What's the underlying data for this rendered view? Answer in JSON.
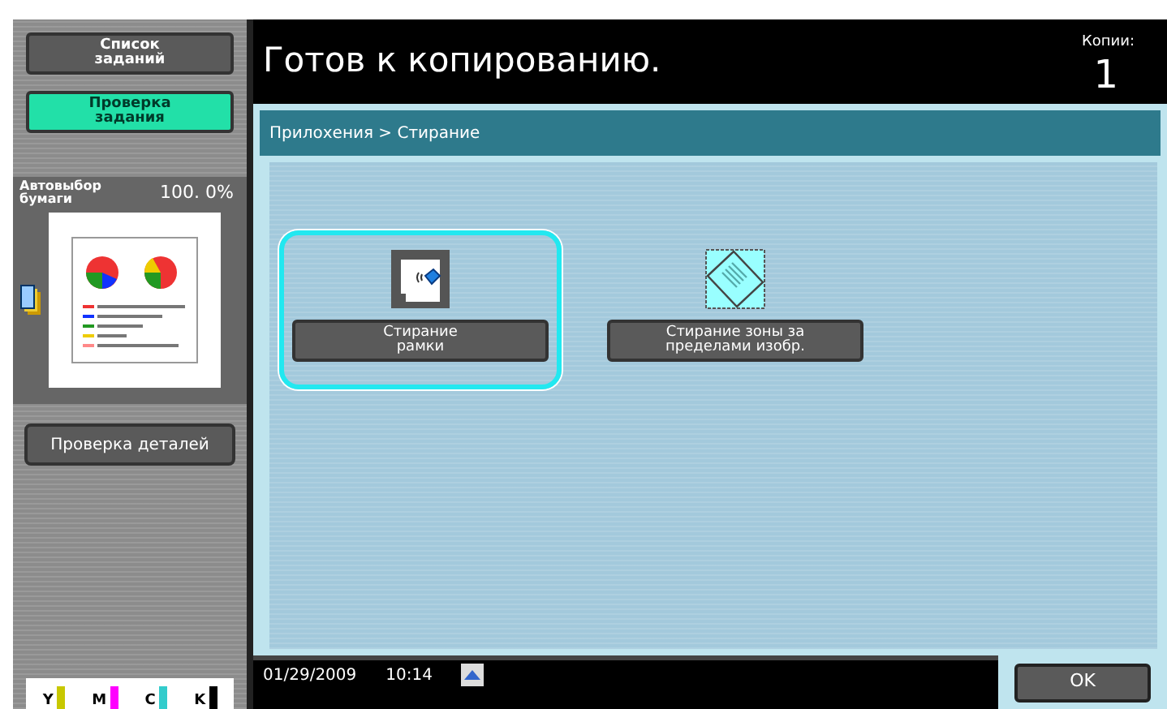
{
  "sidebar": {
    "buttons": [
      {
        "label": "Список\nзаданий",
        "selected": false
      },
      {
        "label": "Проверка\nзадания",
        "selected": true
      }
    ],
    "preview": {
      "paper": "Автовыбор\nбумаги",
      "zoom": "100. 0%"
    },
    "details_button": "Проверка деталей",
    "toners": [
      {
        "label": "Y",
        "color": "#c8c800",
        "level": 1
      },
      {
        "label": "M",
        "color": "#ff00ff",
        "level": 1
      },
      {
        "label": "C",
        "color": "#33cccc",
        "level": 1
      },
      {
        "label": "K",
        "color": "#000000",
        "level": 1
      }
    ]
  },
  "header": {
    "title": "Готов к копированию.",
    "copies_label": "Копии:",
    "copies": "1"
  },
  "breadcrumb": "Прилохения > Стирание",
  "functions": [
    {
      "kind": "frame",
      "label": "Стирание\nрамки",
      "selected": true
    },
    {
      "kind": "outside",
      "label": "Стирание зоны за\nпределами изобр.",
      "selected": false
    }
  ],
  "status_bar": {
    "date": "01/29/2009",
    "time": "10:14"
  },
  "ok_button": "OK"
}
